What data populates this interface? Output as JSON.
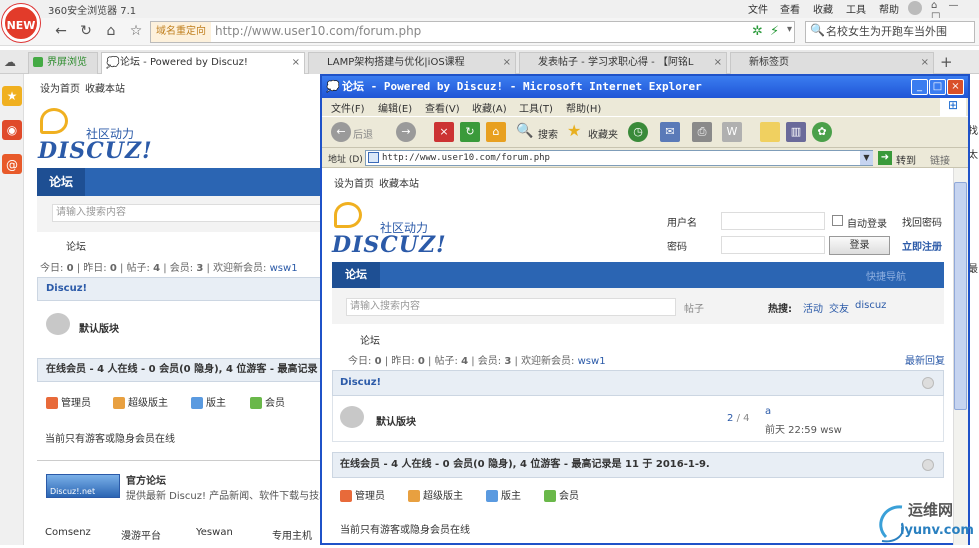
{
  "browser": {
    "app_title": "360安全浏览器 7.1",
    "new_badge": "NEW",
    "menu": [
      "文件",
      "查看",
      "收藏",
      "工具",
      "帮助"
    ],
    "redirect_tag": "域名重定向",
    "url": "http://www.user10.com/forum.php",
    "search_text": "名校女生为开跑车当外围",
    "tabs": [
      {
        "label": "界屏浏览",
        "active": false
      },
      {
        "label": "论坛 - Powered by Discuz!",
        "active": true
      },
      {
        "label": "LAMP架构搭建与优化|iOS课程",
        "active": false
      },
      {
        "label": "发表帖子 - 学习求职心得 - 【阿铭L",
        "active": false
      },
      {
        "label": "新标签页",
        "active": false
      }
    ]
  },
  "page": {
    "top_links": [
      "设为首页",
      "收藏本站"
    ],
    "logo_sub": "社区动力",
    "logo_main": "DISCUZ!",
    "nav_tab": "论坛",
    "search_placeholder": "请输入搜索内容",
    "search_type": "帖子",
    "hot_label": "热搜:",
    "hot_words": [
      "活动",
      "交友",
      "discuz"
    ],
    "breadcrumb": "论坛",
    "stats": {
      "today_label": "今日:",
      "today": "0",
      "yesterday_label": "昨日:",
      "yesterday": "0",
      "posts_label": "帖子:",
      "posts": "4",
      "members_label": "会员:",
      "members": "3",
      "welcome": "欢迎新会员:",
      "newest": "wsw1"
    },
    "latest_reply": "最新回复",
    "category": "Discuz!",
    "forum": {
      "name": "默认版块",
      "threads": "2",
      "slash": "/",
      "posts": "4",
      "last_title": "a",
      "last_time": "前天 22:59",
      "last_user": "wsw"
    },
    "online_title": "在线会员 - 4 人在线 - 0 会员(0 隐身), 4 位游客 - 最高记录是 11 于 2016-1-9.",
    "online_title_short": "在线会员 - 4 人在线 - 0 会员(0 隐身), 4 位游客 - 最高记录",
    "groups": [
      "管理员",
      "超级版主",
      "版主",
      "会员"
    ],
    "online_note": "当前只有游客或隐身会员在线",
    "login": {
      "username_label": "用户名",
      "password_label": "密码",
      "auto_login": "自动登录",
      "find_password": "找回密码",
      "login_button": "登录",
      "register": "立即注册"
    },
    "nav_right": "快捷导航",
    "official": {
      "title": "官方论坛",
      "desc": "提供最新 Discuz! 产品新闻、软件下载与技术",
      "logo_text": "Discuz!.net"
    },
    "footer_links": [
      "Comsenz",
      "漫游平台",
      "Yeswan",
      "专用主机"
    ]
  },
  "ie": {
    "title": "论坛 - Powered by Discuz! - Microsoft Internet Explorer",
    "menu": [
      "文件(F)",
      "编辑(E)",
      "查看(V)",
      "收藏(A)",
      "工具(T)",
      "帮助(H)"
    ],
    "back": "后退",
    "search": "搜索",
    "favorites": "收藏夹",
    "address_label": "地址 (D)",
    "address": "http://www.user10.com/forum.php",
    "go": "转到",
    "links": "链接"
  },
  "right_edge": [
    "找",
    "太",
    "最"
  ],
  "watermark": {
    "cn": "运维网",
    "en": "iyunv.com"
  },
  "colors": {
    "discuz_blue": "#2b65b3",
    "ie_title": "#1f55d6",
    "new_badge": "#e23b2a"
  }
}
